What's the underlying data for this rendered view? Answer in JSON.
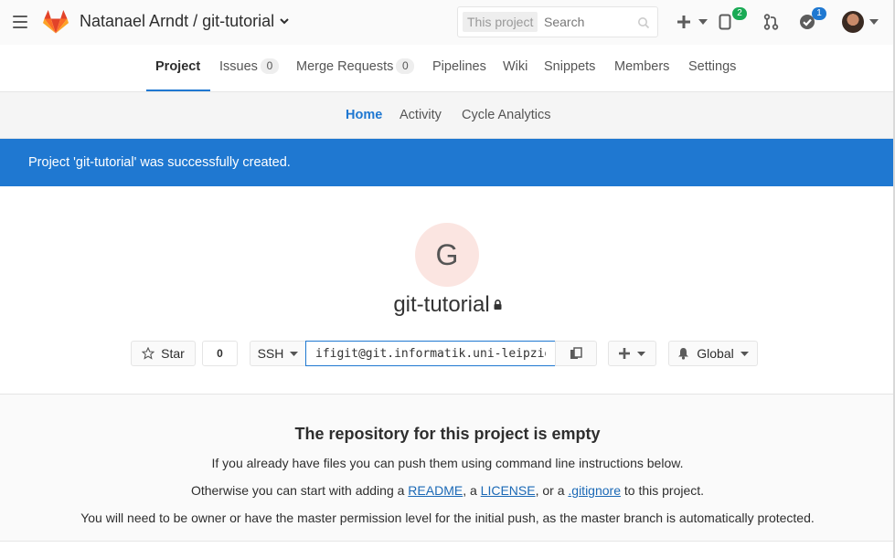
{
  "header": {
    "title": "Natanael Arndt / git-tutorial",
    "search": {
      "scope": "This project",
      "placeholder": "Search"
    },
    "icons": [
      "hamburger-icon",
      "gitlab-logo",
      "plus-icon",
      "issues-icon",
      "merge-request-icon",
      "todo-icon",
      "avatar"
    ],
    "issues_badge": "2",
    "todos_badge": "1"
  },
  "project_nav": {
    "tabs": [
      {
        "label": "Project",
        "active": true
      },
      {
        "label": "Issues",
        "count": "0"
      },
      {
        "label": "Merge Requests",
        "count": "0"
      },
      {
        "label": "Pipelines"
      },
      {
        "label": "Wiki"
      },
      {
        "label": "Snippets"
      },
      {
        "label": "Members"
      },
      {
        "label": "Settings"
      }
    ]
  },
  "sub_nav": {
    "tabs": [
      {
        "label": "Home",
        "active": true
      },
      {
        "label": "Activity"
      },
      {
        "label": "Cycle Analytics"
      }
    ]
  },
  "flash": {
    "message": "Project 'git-tutorial' was successfully created."
  },
  "project": {
    "avatar_letter": "G",
    "name": "git-tutorial",
    "star_label": "Star",
    "star_count": "0",
    "clone_protocol": "SSH",
    "clone_url": "ifigit@git.informatik.uni-leipzig.de:arndtn/git-tutorial.git",
    "notification_label": "Global"
  },
  "empty_repo": {
    "heading": "The repository for this project is empty",
    "line1": "If you already have files you can push them using command line instructions below.",
    "line2_prefix": "Otherwise you can start with adding a ",
    "readme_link": "README",
    "sep1": ", a ",
    "license_link": "LICENSE",
    "sep2": ", or a ",
    "gitignore_link": ".gitignore",
    "line2_suffix": " to this project.",
    "line3": "You will need to be owner or have the master permission level for the initial push, as the master branch is automatically protected."
  },
  "colors": {
    "accent": "#1f78d1",
    "flash_bg": "#1f78d1",
    "avatar_bg": "#fbe5e1",
    "green_badge": "#1aaa55"
  }
}
